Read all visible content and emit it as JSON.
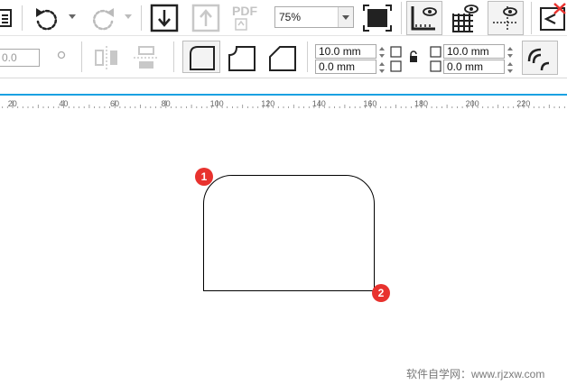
{
  "toolbar": {
    "zoom_value": "75%",
    "pdf_label": "PDF",
    "angle_value": "0.0",
    "undo_icon": "undo-icon",
    "redo_icon": "redo-icon",
    "import_icon": "import-icon",
    "export_icon": "export-icon",
    "fullscreen_icon": "full-screen-icon",
    "rulers_icon": "show-rulers-icon",
    "grid_icon": "show-grid-icon",
    "guides_icon": "show-guides-icon",
    "close_icon": "close-icon"
  },
  "property_bar": {
    "corner_types": [
      "round-corner",
      "scalloped-corner",
      "chamfered-corner"
    ],
    "top_left_radius": "10.0 mm",
    "bottom_left_radius": "0.0 mm",
    "top_right_radius": "10.0 mm",
    "bottom_right_radius": "0.0 mm",
    "lock_icon": "lock-icon"
  },
  "ruler": {
    "labels": [
      "20",
      "40",
      "60",
      "80",
      "100",
      "120",
      "140",
      "160",
      "180",
      "200",
      "220"
    ]
  },
  "annotations": {
    "badge_1": "1",
    "badge_2": "2"
  },
  "watermark": "软件自学网：www.rjzxw.com"
}
